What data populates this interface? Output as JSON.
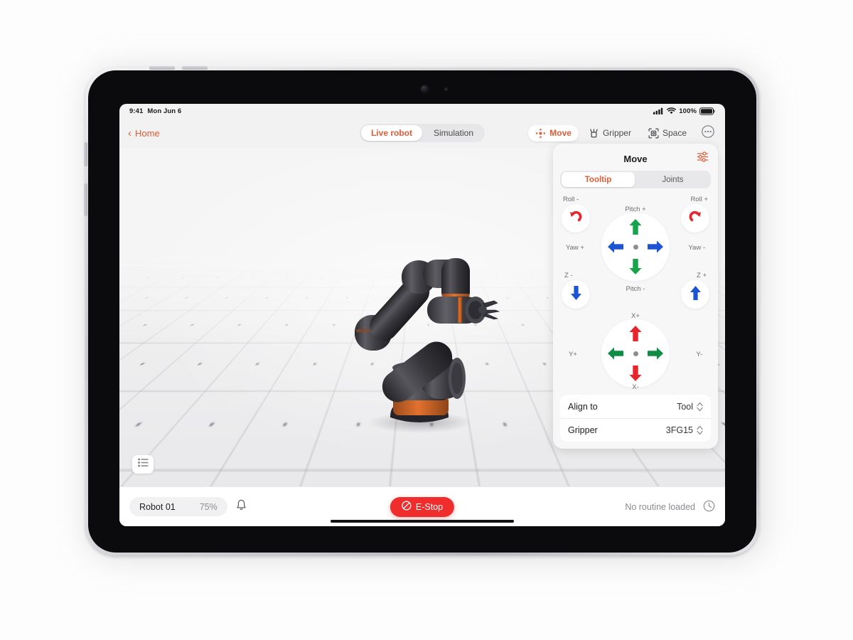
{
  "statusbar": {
    "time": "9:41",
    "date": "Mon Jun 6",
    "battery_pct": "100%",
    "icons": {
      "cellular": "signal-bars-icon",
      "wifi": "wifi-icon",
      "battery": "battery-full-icon"
    }
  },
  "topnav": {
    "back_label": "Home",
    "modes": [
      {
        "label": "Live robot",
        "active": true
      },
      {
        "label": "Simulation",
        "active": false
      }
    ],
    "tools": [
      {
        "label": "Move",
        "icon": "move-arrows-icon",
        "active": true
      },
      {
        "label": "Gripper",
        "icon": "gripper-icon",
        "active": false
      },
      {
        "label": "Space",
        "icon": "space-frame-icon",
        "active": false
      }
    ],
    "more_icon": "more-ellipsis-icon"
  },
  "viewport": {
    "layers_icon": "layers-list-icon",
    "scene": "robot-arm-3d"
  },
  "panel": {
    "title": "Move",
    "settings_icon": "sliders-settings-icon",
    "tabs": [
      {
        "label": "Tooltip",
        "active": true
      },
      {
        "label": "Joints",
        "active": false
      }
    ],
    "rotation_pad": {
      "up_label": "Pitch +",
      "down_label": "Pitch -",
      "left_label": "Yaw +",
      "right_label": "Yaw -",
      "up_color": "#17a34a",
      "down_color": "#17a34a",
      "left_color": "#1b55d6",
      "right_color": "#1b55d6"
    },
    "rotation_corners": [
      {
        "label": "Roll -",
        "icon": "rotate-ccw-icon",
        "color": "#e8242c",
        "pos": "tl"
      },
      {
        "label": "Roll +",
        "icon": "rotate-cw-icon",
        "color": "#e8242c",
        "pos": "tr"
      },
      {
        "label": "Z -",
        "icon": "arrow-down-icon",
        "color": "#1b55d6",
        "pos": "bl"
      },
      {
        "label": "Z +",
        "icon": "arrow-up-icon",
        "color": "#1b55d6",
        "pos": "br"
      }
    ],
    "translation_pad": {
      "up_label": "X+",
      "down_label": "X-",
      "left_label": "Y+",
      "right_label": "Y-",
      "up_color": "#e8242c",
      "down_color": "#e8242c",
      "left_color": "#0f8c45",
      "right_color": "#0f8c45"
    },
    "rows": [
      {
        "label": "Align to",
        "value": "Tool"
      },
      {
        "label": "Gripper",
        "value": "3FG15"
      }
    ]
  },
  "bottombar": {
    "robot_name": "Robot 01",
    "robot_pct": "75%",
    "bell_icon": "bell-icon",
    "estop_label": "E-Stop",
    "estop_icon": "no-entry-icon",
    "routine_status": "No routine loaded",
    "clock_icon": "clock-icon"
  },
  "colors": {
    "accent": "#e05c35",
    "estop_red": "#ef2d2d",
    "green": "#17a34a",
    "blue": "#1b55d6",
    "red": "#e8242c"
  }
}
